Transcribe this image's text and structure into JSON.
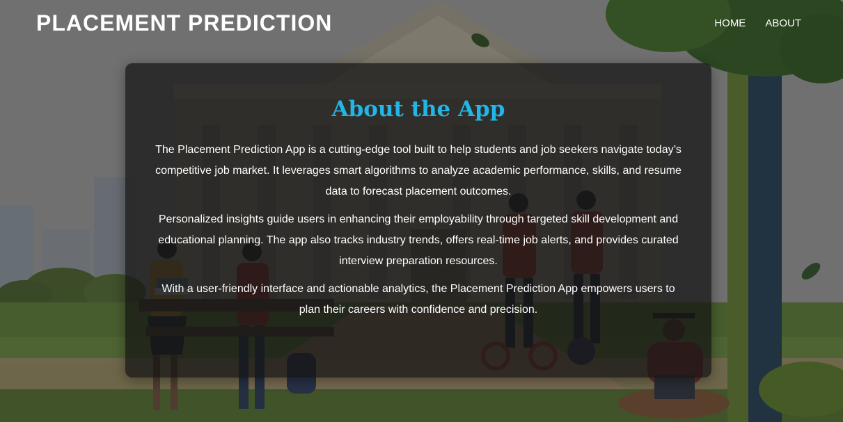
{
  "header": {
    "brand": "PLACEMENT PREDICTION",
    "nav": [
      {
        "label": "HOME"
      },
      {
        "label": "ABOUT"
      }
    ]
  },
  "about": {
    "title": "About the App",
    "paragraphs": [
      "The Placement Prediction App is a cutting-edge tool built to help students and job seekers navigate today’s competitive job market. It leverages smart algorithms to analyze academic performance, skills, and resume data to forecast placement outcomes.",
      "Personalized insights guide users in enhancing their employability through targeted skill development and educational planning. The app also tracks industry trends, offers real-time job alerts, and provides curated interview preparation resources.",
      "With a user-friendly interface and actionable analytics, the Placement Prediction App empowers users to plan their careers with confidence and precision."
    ]
  },
  "colors": {
    "title": "#22b6e6",
    "card_bg": "rgba(20,20,20,0.72)",
    "text": "#ffffff"
  }
}
